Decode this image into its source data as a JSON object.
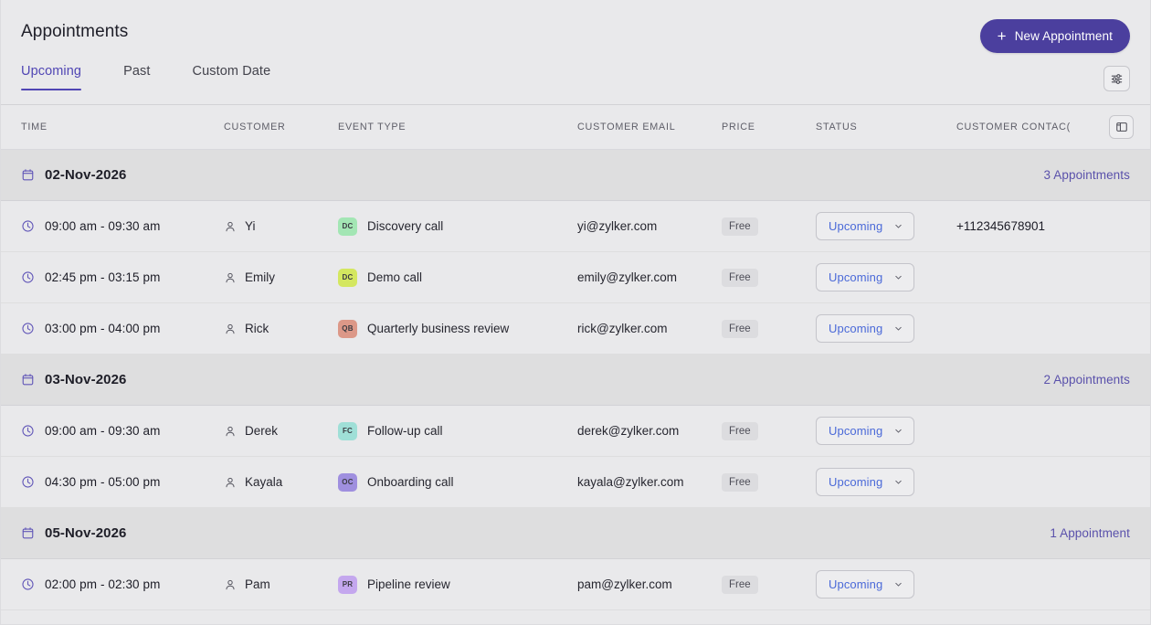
{
  "header": {
    "title": "Appointments",
    "new_appointment_button": "New Appointment",
    "plus_icon": "plus-icon"
  },
  "tabs": [
    {
      "label": "Upcoming",
      "active": true
    },
    {
      "label": "Past",
      "active": false
    },
    {
      "label": "Custom Date",
      "active": false
    }
  ],
  "toolbar": {
    "filter_icon": "sliders-filter-icon",
    "column_settings_icon": "column-layout-icon"
  },
  "table": {
    "columns": [
      {
        "key": "time",
        "label": "TIME"
      },
      {
        "key": "customer",
        "label": "CUSTOMER"
      },
      {
        "key": "event_type",
        "label": "EVENT TYPE"
      },
      {
        "key": "customer_email",
        "label": "CUSTOMER EMAIL"
      },
      {
        "key": "price",
        "label": "PRICE"
      },
      {
        "key": "status",
        "label": "STATUS"
      },
      {
        "key": "customer_contact",
        "label": "CUSTOMER CONTAC("
      }
    ],
    "groups": [
      {
        "date": "02-Nov-2026",
        "count_label": "3 Appointments",
        "rows": [
          {
            "time": "09:00 am - 09:30 am",
            "customer": "Yi",
            "event_code": "DC",
            "event_color": "#a3e6b4",
            "event_type": "Discovery call",
            "customer_email": "yi@zylker.com",
            "price": "Free",
            "status": "Upcoming",
            "customer_contact": "+112345678901"
          },
          {
            "time": "02:45 pm - 03:15 pm",
            "customer": "Emily",
            "event_code": "DC",
            "event_color": "#d4e760",
            "event_type": "Demo call",
            "customer_email": "emily@zylker.com",
            "price": "Free",
            "status": "Upcoming",
            "customer_contact": ""
          },
          {
            "time": "03:00 pm - 04:00 pm",
            "customer": "Rick",
            "event_code": "QB",
            "event_color": "#dc9888",
            "event_type": "Quarterly business review",
            "customer_email": "rick@zylker.com",
            "price": "Free",
            "status": "Upcoming",
            "customer_contact": ""
          }
        ]
      },
      {
        "date": "03-Nov-2026",
        "count_label": "2 Appointments",
        "rows": [
          {
            "time": "09:00 am - 09:30 am",
            "customer": "Derek",
            "event_code": "FC",
            "event_color": "#9fdfd7",
            "event_type": "Follow-up call",
            "customer_email": "derek@zylker.com",
            "price": "Free",
            "status": "Upcoming",
            "customer_contact": ""
          },
          {
            "time": "04:30 pm - 05:00 pm",
            "customer": "Kayala",
            "event_code": "OC",
            "event_color": "#9f8fdf",
            "event_type": "Onboarding call",
            "customer_email": "kayala@zylker.com",
            "price": "Free",
            "status": "Upcoming",
            "customer_contact": ""
          }
        ]
      },
      {
        "date": "05-Nov-2026",
        "count_label": "1 Appointment",
        "rows": [
          {
            "time": "02:00 pm - 02:30 pm",
            "customer": "Pam",
            "event_code": "PR",
            "event_color": "#c4a7ee",
            "event_type": "Pipeline review",
            "customer_email": "pam@zylker.com",
            "price": "Free",
            "status": "Upcoming",
            "customer_contact": ""
          }
        ]
      }
    ]
  },
  "colors": {
    "accent": "#4b3f9e",
    "tab_active": "#5046b4",
    "link": "#5a51ab",
    "status_text": "#4a69d8",
    "page_bg": "#e9e9eb",
    "group_bg": "#dededf"
  },
  "icons": {
    "date_group": "calendar-icon",
    "time": "clock-icon",
    "customer": "person-icon",
    "status_chevron": "chevron-down-icon"
  }
}
